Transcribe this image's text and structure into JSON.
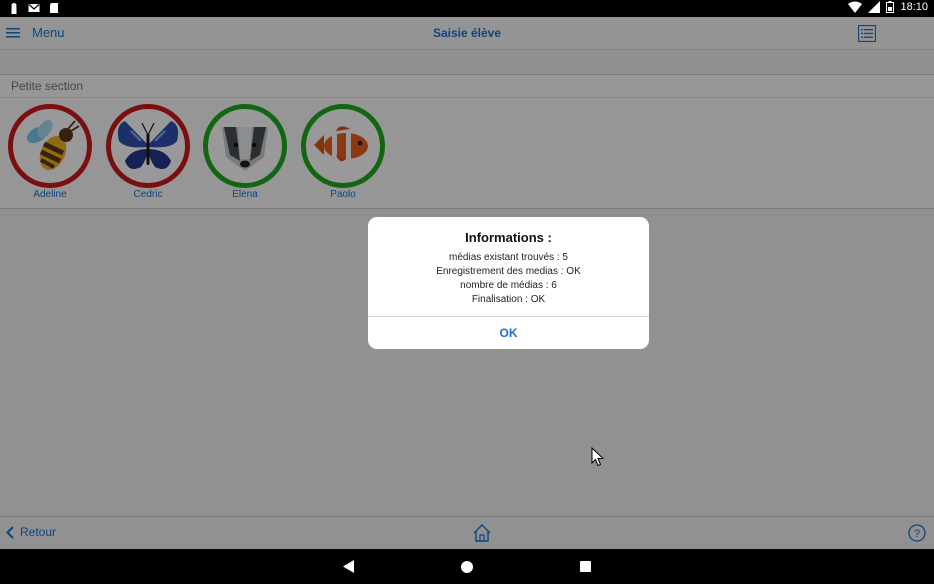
{
  "status_bar": {
    "time": "18:10",
    "left_icons": [
      "keyhole-icon",
      "gmail-icon",
      "sd-card-icon"
    ],
    "right_icons": [
      "wifi-icon",
      "signal-icon",
      "battery-icon"
    ]
  },
  "header": {
    "menu_label": "Menu",
    "title": "Saisie élève",
    "menu_icon": "hamburger-icon",
    "list_icon": "list-icon"
  },
  "section": {
    "title": "Petite section",
    "students": [
      {
        "name": "Adeline",
        "animal": "bee",
        "status_color": "#cc1a1a"
      },
      {
        "name": "Cedric",
        "animal": "butterfly",
        "status_color": "#cc1a1a"
      },
      {
        "name": "Elena",
        "animal": "badger",
        "status_color": "#1faa1f"
      },
      {
        "name": "Paolo",
        "animal": "clownfish",
        "status_color": "#1faa1f"
      }
    ]
  },
  "footer": {
    "back_label": "Retour",
    "home_icon": "home-icon",
    "help_icon": "help-icon"
  },
  "dialog": {
    "title": "Informations :",
    "lines": [
      "médias existant trouvés : 5",
      "Enregistrement des medias : OK",
      "nombre de médias : 6",
      "Finalisation : OK"
    ],
    "ok_label": "OK"
  },
  "colors": {
    "accent": "#1a73c9",
    "red_status": "#cc1a1a",
    "green_status": "#1faa1f"
  }
}
